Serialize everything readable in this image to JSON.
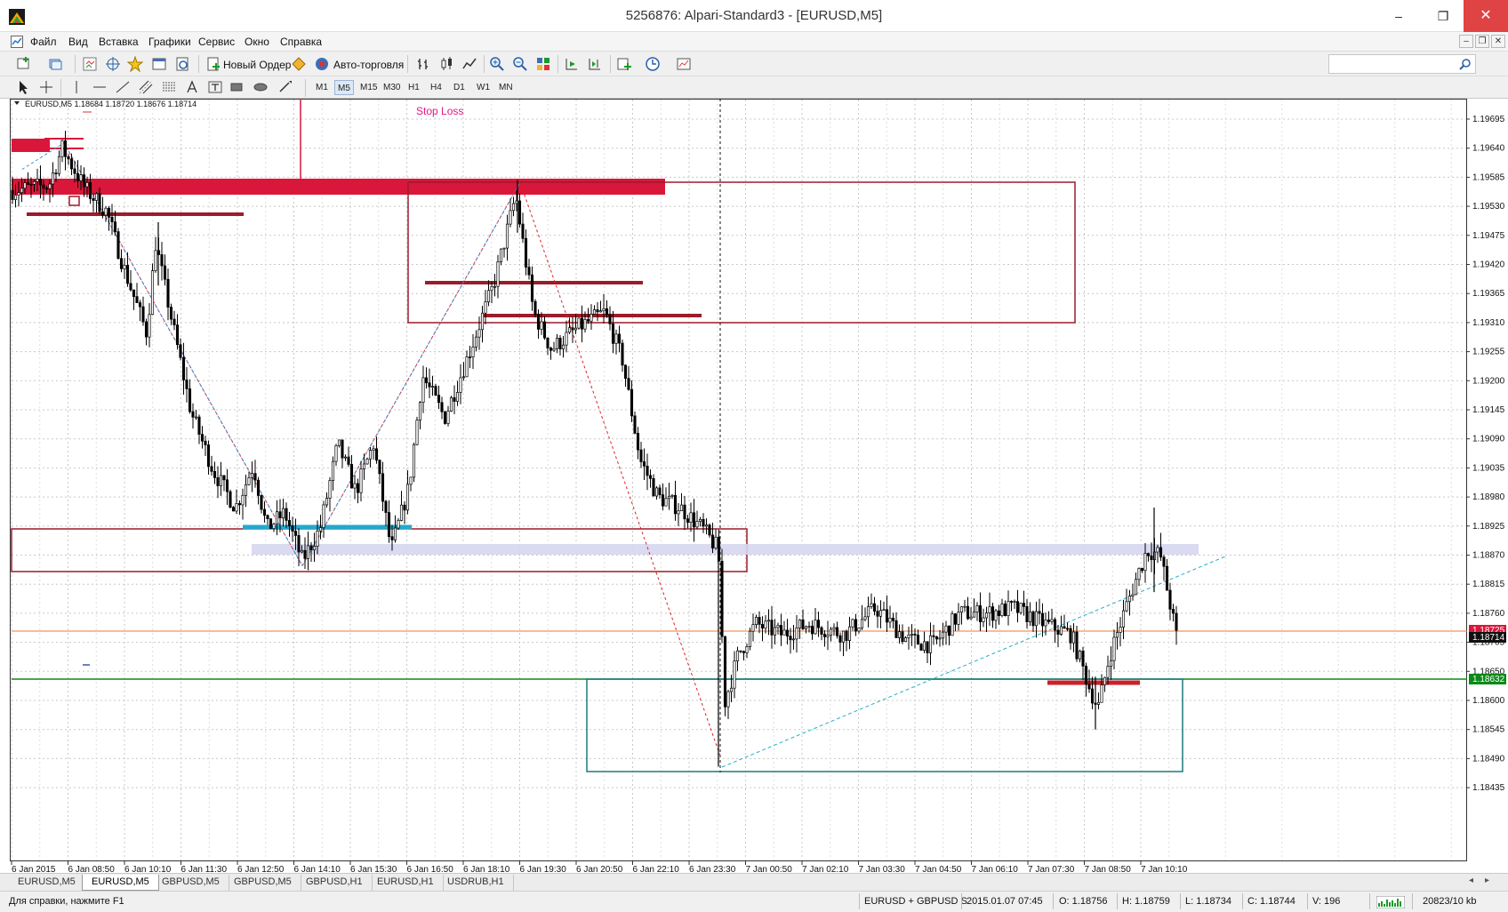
{
  "window": {
    "title": "5256876: Alpari-Standard3 - [EURUSD,M5]",
    "minimize": "–",
    "maximize": "❐",
    "close": "✕"
  },
  "menu": [
    "Файл",
    "Вид",
    "Вставка",
    "Графики",
    "Сервис",
    "Окно",
    "Справка"
  ],
  "mdi": {
    "minimize": "–",
    "restore": "❐",
    "close": "✕"
  },
  "toolbar": {
    "new_order": "Новый Ордер",
    "auto_trading": "Авто-торговля"
  },
  "timeframes": [
    "M1",
    "M5",
    "M15",
    "M30",
    "H1",
    "H4",
    "D1",
    "W1",
    "MN"
  ],
  "active_timeframe": "M5",
  "chart": {
    "header": "EURUSD,M5  1.18684 1.18720 1.18676 1.18714",
    "stop_loss_label": "Stop Loss",
    "price_labels": [
      "1.19695",
      "1.19640",
      "1.19585",
      "1.19530",
      "1.19475",
      "1.19420",
      "1.19365",
      "1.19310",
      "1.19255",
      "1.19200",
      "1.19145",
      "1.19090",
      "1.19035",
      "1.18980",
      "1.18925",
      "1.18870",
      "1.18815",
      "1.18760",
      "1.18705",
      "1.18650",
      "1.18600",
      "1.18545",
      "1.18490",
      "1.18435"
    ],
    "time_labels": [
      "6 Jan 2015",
      "6 Jan 08:50",
      "6 Jan 10:10",
      "6 Jan 11:30",
      "6 Jan 12:50",
      "6 Jan 14:10",
      "6 Jan 15:30",
      "6 Jan 16:50",
      "6 Jan 18:10",
      "6 Jan 19:30",
      "6 Jan 20:50",
      "6 Jan 22:10",
      "6 Jan 23:30",
      "7 Jan 00:50",
      "7 Jan 02:10",
      "7 Jan 03:30",
      "7 Jan 04:50",
      "7 Jan 06:10",
      "7 Jan 07:30",
      "7 Jan 08:50",
      "7 Jan 10:10"
    ],
    "current_price": "1.18714",
    "price_badge_orange": "1.18725",
    "price_badge_green": "1.18632",
    "colors": {
      "crimson": "#d9173a",
      "maroon": "#9b1c2a",
      "green": "#0b8a17",
      "orange": "#f07a3a",
      "teal": "#1b7a7a",
      "lavender": "#d6d6f0",
      "cyan": "#22aacc",
      "grid": "#c8c8c8"
    }
  },
  "tabs": [
    "EURUSD,M5",
    "EURUSD,M5",
    "GBPUSD,M5",
    "GBPUSD,M5",
    "GBPUSD,H1",
    "EURUSD,H1",
    "USDRUB,H1"
  ],
  "active_tab_index": 1,
  "status": {
    "help": "Для справки, нажмите F1",
    "symbol": "EURUSD + GBPUSD S",
    "datetime": "2015.01.07 07:45",
    "open": "O: 1.18756",
    "high": "H: 1.18759",
    "low": "L: 1.18734",
    "close": "C: 1.18744",
    "volume": "V: 196",
    "traffic": "20823/10 kb"
  }
}
